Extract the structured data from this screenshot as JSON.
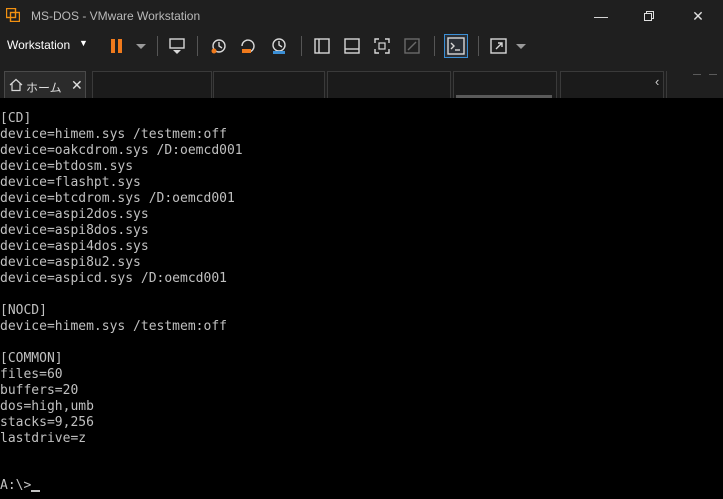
{
  "window": {
    "title": "MS-DOS - VMware Workstation",
    "min_glyph": "—",
    "max_glyph": "❐",
    "close_glyph": "✕"
  },
  "toolbar": {
    "menu_label": "Workstation",
    "menu_caret": "▼",
    "pause_color": "#f07a1c"
  },
  "tabs": {
    "home_label": "ホーム",
    "close_glyph": "✕",
    "scroll_glyph": "‹"
  },
  "console": {
    "lines": [
      "[CD]",
      "device=himem.sys /testmem:off",
      "device=oakcdrom.sys /D:oemcd001",
      "device=btdosm.sys",
      "device=flashpt.sys",
      "device=btcdrom.sys /D:oemcd001",
      "device=aspi2dos.sys",
      "device=aspi8dos.sys",
      "device=aspi4dos.sys",
      "device=aspi8u2.sys",
      "device=aspicd.sys /D:oemcd001",
      "",
      "[NOCD]",
      "device=himem.sys /testmem:off",
      "",
      "[COMMON]",
      "files=60",
      "buffers=20",
      "dos=high,umb",
      "stacks=9,256",
      "lastdrive=z"
    ],
    "prompt": "A:\\>"
  }
}
